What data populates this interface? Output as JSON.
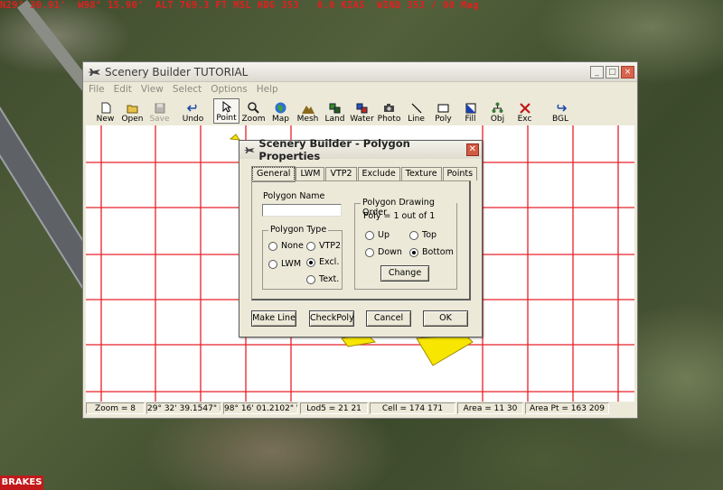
{
  "hud_text": "N29° 30.91'  W98° 15.90'  ALT 769.3 FT MSL HDG 353   0.0 KIAS  WIND 353 / 00 Mag",
  "brakes_text": "BRAKES",
  "window": {
    "title": "Scenery Builder  TUTORIAL",
    "menu": [
      "File",
      "Edit",
      "View",
      "Select",
      "Options",
      "Help"
    ],
    "toolbar": [
      {
        "label": "New",
        "icon": "new-file-icon"
      },
      {
        "label": "Open",
        "icon": "open-folder-icon"
      },
      {
        "label": "Save",
        "icon": "save-disk-icon"
      },
      {
        "label": "Undo",
        "icon": "undo-arrow-icon"
      },
      {
        "label": "Point",
        "icon": "pointer-arrow-icon"
      },
      {
        "label": "Zoom",
        "icon": "magnifier-icon"
      },
      {
        "label": "Map",
        "icon": "globe-icon"
      },
      {
        "label": "Mesh",
        "icon": "mountain-icon"
      },
      {
        "label": "Land",
        "icon": "land-icon"
      },
      {
        "label": "Water",
        "icon": "water-icon"
      },
      {
        "label": "Photo",
        "icon": "camera-icon"
      },
      {
        "label": "Line",
        "icon": "line-icon"
      },
      {
        "label": "Poly",
        "icon": "rectangle-icon"
      },
      {
        "label": "Fill",
        "icon": "fill-icon"
      },
      {
        "label": "Obj",
        "icon": "object-icon"
      },
      {
        "label": "Exc",
        "icon": "exclude-x-icon"
      },
      {
        "label": "BGL",
        "icon": "redo-arrow-icon"
      }
    ],
    "status": [
      "Zoom = 8",
      "29° 32' 39.1547\" N",
      "98° 16' 01.2102\" W",
      "Lod5 = 21 21",
      "Cell = 174 171",
      "Area = 11 30",
      "Area Pt = 163 209"
    ]
  },
  "dialog": {
    "title": "Scenery Builder - Polygon Properties",
    "tabs": [
      "General",
      "LWM",
      "VTP2",
      "Exclude",
      "Texture",
      "Points"
    ],
    "polygon_name_label": "Polygon Name",
    "polygon_name_value": "",
    "polygon_type_label": "Polygon Type",
    "polygon_types": {
      "none": "None",
      "vtp2": "VTP2",
      "lwm": "LWM",
      "excl": "Excl.",
      "text": "Text."
    },
    "drawing_order_label": "Polygon Drawing Order",
    "poly_count": "Poly = 1 out of 1",
    "orders": {
      "up": "Up",
      "top": "Top",
      "down": "Down",
      "bottom": "Bottom"
    },
    "change_label": "Change",
    "buttons": {
      "make_line": "Make Line",
      "check_poly": "CheckPoly",
      "cancel": "Cancel",
      "ok": "OK"
    }
  },
  "colors": {
    "grid": "#e8202a",
    "polygon": "#f7e600",
    "titlebar": "#dedbcf",
    "hud": "#e02020"
  }
}
